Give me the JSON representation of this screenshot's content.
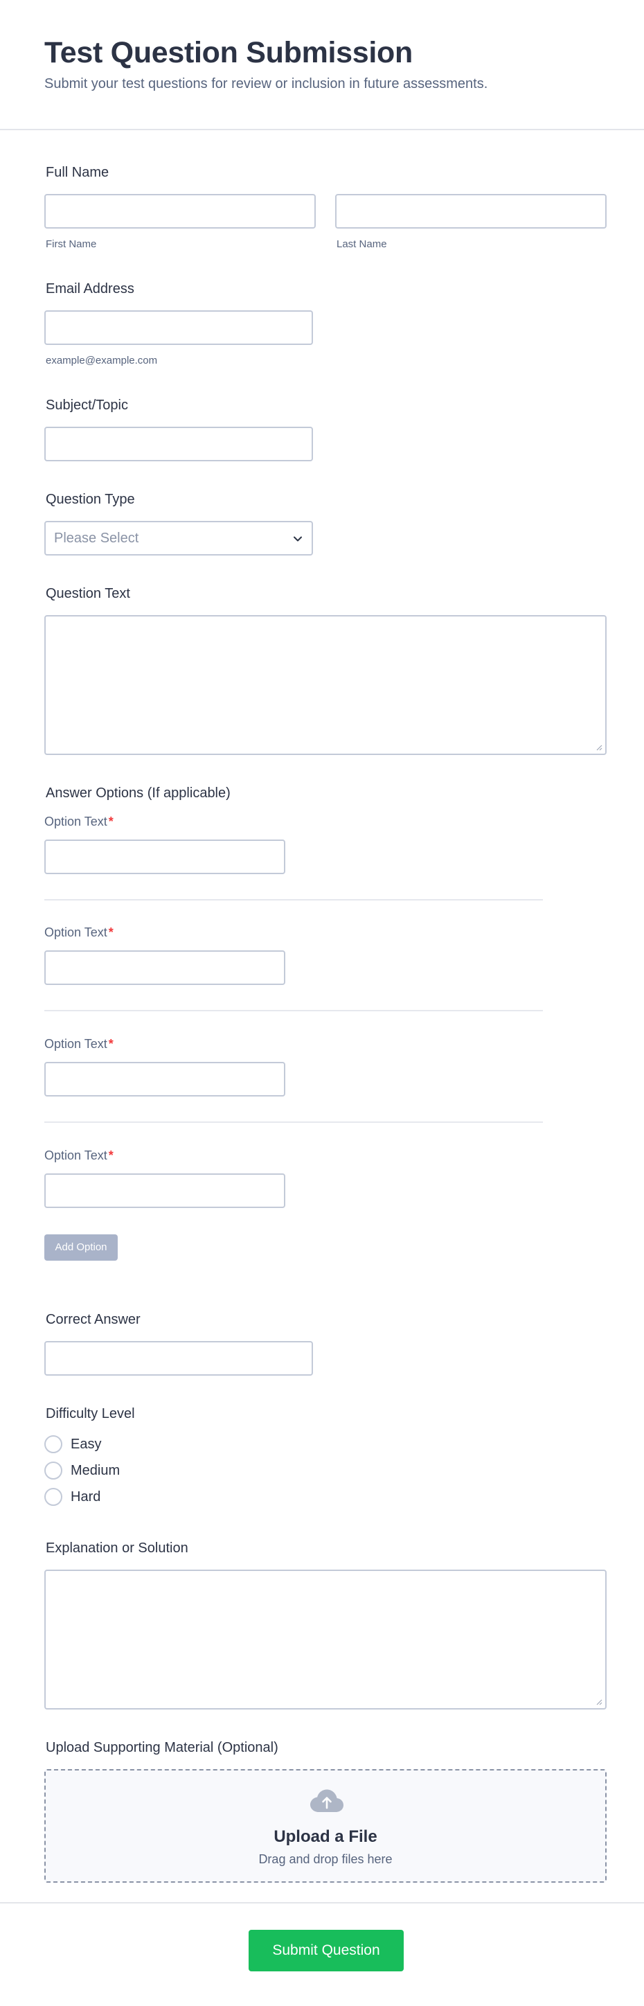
{
  "header": {
    "title": "Test Question Submission",
    "subtitle": "Submit your test questions for review or inclusion in future assessments."
  },
  "full_name": {
    "label": "Full Name",
    "first_sublabel": "First Name",
    "last_sublabel": "Last Name",
    "first_value": "",
    "last_value": ""
  },
  "email": {
    "label": "Email Address",
    "sublabel": "example@example.com",
    "value": ""
  },
  "subject": {
    "label": "Subject/Topic",
    "value": ""
  },
  "question_type": {
    "label": "Question Type",
    "selected": "Please Select"
  },
  "question_text": {
    "label": "Question Text",
    "value": ""
  },
  "answer_options": {
    "label": "Answer Options (If applicable)",
    "items": [
      {
        "label": "Option Text",
        "required": "*",
        "value": ""
      },
      {
        "label": "Option Text",
        "required": "*",
        "value": ""
      },
      {
        "label": "Option Text",
        "required": "*",
        "value": ""
      },
      {
        "label": "Option Text",
        "required": "*",
        "value": ""
      }
    ],
    "add_button": "Add Option"
  },
  "correct_answer": {
    "label": "Correct Answer",
    "value": ""
  },
  "difficulty": {
    "label": "Difficulty Level",
    "options": [
      "Easy",
      "Medium",
      "Hard"
    ]
  },
  "explanation": {
    "label": "Explanation or Solution",
    "value": ""
  },
  "upload": {
    "label": "Upload Supporting Material (Optional)",
    "title": "Upload a File",
    "subtitle": "Drag and drop files here",
    "icon": "cloud-upload-icon"
  },
  "submit": {
    "label": "Submit Question"
  },
  "colors": {
    "submit": "#18bd5b",
    "add_button": "#a9b3c9",
    "required": "#f23a3c",
    "border": "#c3cad8"
  }
}
